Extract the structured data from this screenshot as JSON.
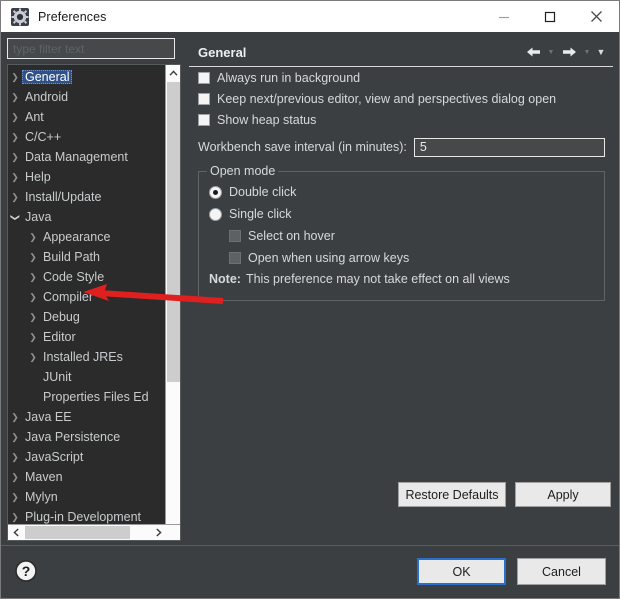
{
  "window": {
    "title": "Preferences",
    "icon": "preferences-gear-icon",
    "controls": {
      "minimize": "minimize-icon",
      "maximize": "maximize-icon",
      "close": "close-icon"
    }
  },
  "filter": {
    "placeholder": "type filter text",
    "value": ""
  },
  "tree": {
    "selected": "General",
    "items": [
      {
        "label": "General",
        "level": 1,
        "twisty": "collapsed",
        "selected": true
      },
      {
        "label": "Android",
        "level": 1,
        "twisty": "collapsed",
        "selected": false
      },
      {
        "label": "Ant",
        "level": 1,
        "twisty": "collapsed",
        "selected": false
      },
      {
        "label": "C/C++",
        "level": 1,
        "twisty": "collapsed",
        "selected": false
      },
      {
        "label": "Data Management",
        "level": 1,
        "twisty": "collapsed",
        "selected": false
      },
      {
        "label": "Help",
        "level": 1,
        "twisty": "collapsed",
        "selected": false
      },
      {
        "label": "Install/Update",
        "level": 1,
        "twisty": "collapsed",
        "selected": false
      },
      {
        "label": "Java",
        "level": 1,
        "twisty": "expanded",
        "selected": false
      },
      {
        "label": "Appearance",
        "level": 2,
        "twisty": "collapsed",
        "selected": false
      },
      {
        "label": "Build Path",
        "level": 2,
        "twisty": "collapsed",
        "selected": false
      },
      {
        "label": "Code Style",
        "level": 2,
        "twisty": "collapsed",
        "selected": false
      },
      {
        "label": "Compiler",
        "level": 2,
        "twisty": "collapsed",
        "selected": false
      },
      {
        "label": "Debug",
        "level": 2,
        "twisty": "collapsed",
        "selected": false
      },
      {
        "label": "Editor",
        "level": 2,
        "twisty": "collapsed",
        "selected": false
      },
      {
        "label": "Installed JREs",
        "level": 2,
        "twisty": "collapsed",
        "selected": false
      },
      {
        "label": "JUnit",
        "level": 2,
        "twisty": "none",
        "selected": false
      },
      {
        "label": "Properties Files Ed",
        "level": 2,
        "twisty": "none",
        "selected": false
      },
      {
        "label": "Java EE",
        "level": 1,
        "twisty": "collapsed",
        "selected": false
      },
      {
        "label": "Java Persistence",
        "level": 1,
        "twisty": "collapsed",
        "selected": false
      },
      {
        "label": "JavaScript",
        "level": 1,
        "twisty": "collapsed",
        "selected": false
      },
      {
        "label": "Maven",
        "level": 1,
        "twisty": "collapsed",
        "selected": false
      },
      {
        "label": "Mylyn",
        "level": 1,
        "twisty": "collapsed",
        "selected": false
      },
      {
        "label": "Plug-in Development",
        "level": 1,
        "twisty": "collapsed",
        "selected": false
      }
    ]
  },
  "pane": {
    "title": "General",
    "nav": {
      "back": "back-arrow-icon",
      "back_menu": "chevron-down-icon",
      "forward": "forward-arrow-icon",
      "forward_menu": "chevron-down-icon",
      "view_menu": "view-menu-icon"
    },
    "checkboxes": [
      {
        "label": "Always run in background",
        "checked": false,
        "enabled": true
      },
      {
        "label": "Keep next/previous editor, view and perspectives dialog open",
        "checked": false,
        "enabled": true
      },
      {
        "label": "Show heap status",
        "checked": false,
        "enabled": true
      }
    ],
    "save_interval": {
      "label": "Workbench save interval (in minutes):",
      "value": "5"
    },
    "open_mode": {
      "title": "Open mode",
      "radios": [
        {
          "label": "Double click",
          "selected": true
        },
        {
          "label": "Single click",
          "selected": false
        }
      ],
      "sub_checkboxes": [
        {
          "label": "Select on hover",
          "checked": false,
          "enabled": false
        },
        {
          "label": "Open when using arrow keys",
          "checked": false,
          "enabled": false
        }
      ],
      "note_prefix": "Note:",
      "note_text": "This preference may not take effect on all views"
    },
    "buttons": {
      "restore_defaults": "Restore Defaults",
      "apply": "Apply"
    }
  },
  "footer": {
    "help": "help-icon",
    "ok": "OK",
    "cancel": "Cancel"
  },
  "annotation": {
    "type": "red-arrow",
    "color": "#e01f1f",
    "points_to": "Compiler"
  },
  "colors": {
    "dialog_bg": "#3c3f41",
    "tree_bg": "#2b2b2b",
    "selection": "#2f5186",
    "titlebar": "#ffffff",
    "accent": "#2a6fc9",
    "annotation": "#e01f1f"
  }
}
